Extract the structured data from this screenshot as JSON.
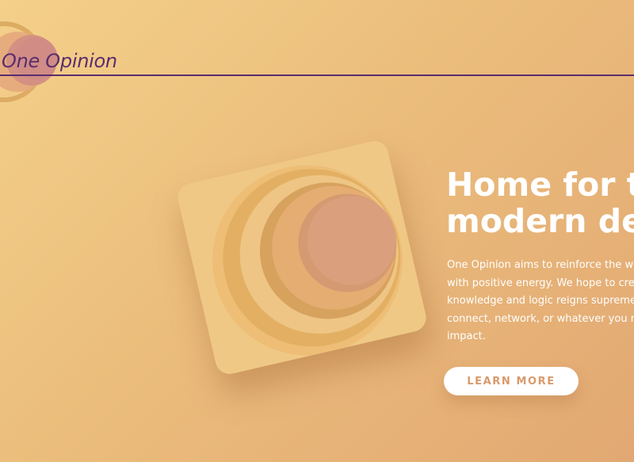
{
  "header": {
    "brand": "One Opinion",
    "logo_icon": "concentric-circles-logo-icon"
  },
  "hero": {
    "title_line1": "Home for th",
    "title_line2": "modern dev",
    "description_lines": [
      "One Opinion aims to reinforce the web",
      "with positive energy. We hope to create",
      "knowledge and logic reigns supreme. Jo",
      "connect, network, or whatever you migh",
      "impact."
    ],
    "cta_label": "LEARN MORE",
    "art_icon": "concentric-circles-tile-icon"
  },
  "colors": {
    "brand": "#5a2d6e",
    "background_start": "#f4d08a",
    "background_end": "#e2a873",
    "accent_pink": "#d99a7e",
    "cta_text": "#d99a6c"
  }
}
